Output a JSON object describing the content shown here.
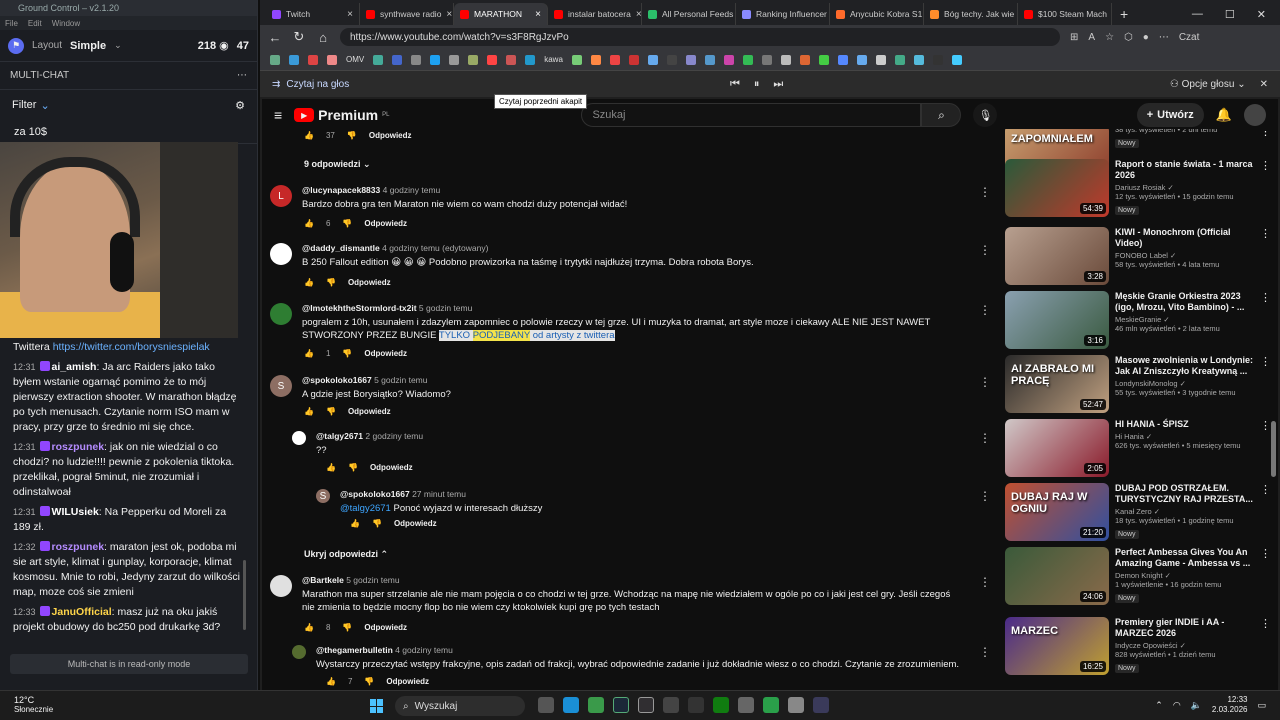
{
  "gc": {
    "title": "Ground Control – v2.1.20",
    "menu": [
      "File",
      "Edit",
      "Window"
    ],
    "layout_label": "Layout",
    "layout_value": "Simple",
    "viewers": "218",
    "viewers2": "47",
    "section": "MULTI-CHAT",
    "filter": "Filter",
    "pinned": "za 10$",
    "readonly": "Multi-chat is in read-only mode",
    "chat": [
      {
        "pre": "Twittera",
        "link": "https://twitter.com/borysniespielak"
      },
      {
        "time": "12:31",
        "user": "ai_amish",
        "color": "#ffffff",
        "text": "Ja arc Raiders jako tako byłem wstanie ogarnąć pomimo że to mój pierwszy extraction shooter. W marathon błądzę po tych menusach. Czytanie norm ISO mam w pracy, przy grze to średnio mi się chce."
      },
      {
        "time": "12:31",
        "user": "roszpunek",
        "color": "#b58cff",
        "text": "jak on nie wiedzial o co chodzi? no ludzie!!!! pewnie z pokolenia tiktoka. przeklikał, pograł 5minut, nie zrozumiał i odinstalwoał"
      },
      {
        "time": "12:31",
        "user": "WILUsiek",
        "color": "#ffffff",
        "text": "Na Pepperku od Moreli za 189 zł."
      },
      {
        "time": "12:32",
        "user": "roszpunek",
        "color": "#b58cff",
        "text": "maraton jest ok, podoba mi sie art style, klimat i gunplay, korporacje, klimat kosmosu. Mnie to robi, Jedyny zarzut do wilkości map, moze coś sie zmieni"
      },
      {
        "time": "12:33",
        "user": "JanuOfficial",
        "color": "#ffd54a",
        "text": "masz już na oku jakiś projekt obudowy do bc250 pod drukarkę 3d?"
      }
    ]
  },
  "browser": {
    "tabs": [
      {
        "label": "Twitch",
        "color": "#9146ff"
      },
      {
        "label": "synthwave radio",
        "color": "#ff0000"
      },
      {
        "label": "MARATHON",
        "color": "#ff0000",
        "active": true
      },
      {
        "label": "instalar batocera",
        "color": "#ff0000"
      },
      {
        "label": "All Personal Feeds",
        "color": "#2bbf6a"
      },
      {
        "label": "Ranking Influencer",
        "color": "#8a8aff"
      },
      {
        "label": "Anycubic Kobra S1",
        "color": "#ff6a2b"
      },
      {
        "label": "Bóg techy. Jak wie",
        "color": "#ff8c2b"
      },
      {
        "label": "$100 Steam Mach",
        "color": "#ff0000"
      }
    ],
    "url": "https://www.youtube.com/watch?v=s3F8RgJzvPo",
    "bookmark_label": "OMV",
    "bookmark_label2": "kawa",
    "reader_label": "Czytaj na głos",
    "reader_options": "Opcje głosu",
    "tooltip": "Czytaj poprzedni akapit",
    "chat_btn": "Czat"
  },
  "yt": {
    "logo": "Premium",
    "logo_sup": "PL",
    "search_placeholder": "Szukaj",
    "create": "Utwórz",
    "reply": "Odpowiedz",
    "replies_count": "9 odpowiedzi",
    "hide_replies": "Ukryj odpowiedzi",
    "comments": [
      {
        "likes": "37",
        "top": 0
      },
      {
        "author": "@lucynapacek8833",
        "time": "4 godziny temu",
        "text": "Bardzo dobra gra ten Maraton nie wiem co wam chodzi duży potencjał widać!",
        "likes": "6",
        "color": "#c62828",
        "letter": "L"
      },
      {
        "author": "@daddy_dismantle",
        "time": "4 godziny temu (edytowany)",
        "text": "B 250 Fallout edition 😀 😀 😀  Podobno prowizorka na taśmę i trytytki najdłużej trzyma. Dobra robota Borys.",
        "likes": "",
        "color": "#ffffff"
      },
      {
        "author": "@ImotekhtheStormlord-tx2it",
        "time": "5 godzin temu",
        "text1": "pogralem z 10h, usunałem i zdazylem zapomniec o polowie rzeczy w tej grze. UI i muzyka to dramat, art style moze i ciekawy ALE NIE JEST NAWET STWORZONY PRZEZ BUNGIE ",
        "hl_a": "TYLKO ",
        "hl_b": "PODJEBANY",
        "hl_c": " od artysty z twittera",
        "likes": "1",
        "color": "#2e7d32"
      },
      {
        "author": "@spokoloko1667",
        "time": "5 godzin temu",
        "text": "A gdzie jest Borysiątko? Wiadomo?",
        "likes": "",
        "color": "#8d6e63",
        "letter": "S"
      },
      {
        "author": "@talgy2671",
        "time": "2 godziny temu",
        "text": "??",
        "color": "#ffffff"
      },
      {
        "author": "@spokoloko1667",
        "time": "27 minut temu",
        "mention": "@talgy2671",
        "text": "Ponoć wyjazd w interesach dłuższy",
        "color": "#8d6e63",
        "letter": "S"
      },
      {
        "author": "@Bartkele",
        "time": "5 godzin temu",
        "text": "Marathon ma super strzelanie ale nie mam pojęcia o co chodzi w tej grze. Wchodząc na mapę nie wiedziałem w ogóle po co i jaki jest cel gry. Jeśli czegoś nie zmienia to będzie mocny flop bo nie wiem czy ktokolwiek kupi grę po tych testach",
        "likes": "8",
        "color": "#e0e0e0"
      },
      {
        "author": "@thegamerbulletin",
        "time": "4 godziny temu",
        "text": "Wystarczy przeczytać wstępy frakcyjne, opis zadań od frakcji, wybrać odpowiednie zadanie i już dokładnie wiesz o co chodzi. Czytanie ze zrozumieniem.",
        "likes": "7",
        "color": "#556b2f"
      }
    ],
    "videos": [
      {
        "title": "",
        "channel": "",
        "meta": "38 tys. wyświetleń • 2 dni temu",
        "badge": "Nowy",
        "dur": "22:17",
        "c1": "#c8a070",
        "c2": "#8b3a2a",
        "thumb_text": "ZAPOMNIAŁEM"
      },
      {
        "title": "Raport o stanie świata - 1 marca 2026",
        "channel": "Dariusz Rosiak",
        "meta": "12 tys. wyświetleń • 15 godzin temu",
        "badge": "Nowy",
        "dur": "54:39",
        "c1": "#2a5a3a",
        "c2": "#c0392b"
      },
      {
        "title": "KIWI - Monochrom (Official Video)",
        "channel": "FONOBO Label",
        "meta": "58 tys. wyświetleń • 4 lata temu",
        "badge": "",
        "dur": "3:28",
        "c1": "#b8a090",
        "c2": "#6a4a3a"
      },
      {
        "title": "Męskie Granie Orkiestra 2023 (igo, Mrozu, Vito Bambino) - ...",
        "channel": "MeskieGranie",
        "meta": "46 mln wyświetleń • 2 lata temu",
        "badge": "",
        "dur": "3:16",
        "c1": "#8aa0b0",
        "c2": "#3a5a40"
      },
      {
        "title": "Masowe zwolnienia w Londynie: Jak AI Zniszczyło Kreatywną ...",
        "channel": "LondynskiMonolog",
        "meta": "55 tys. wyświetleń • 3 tygodnie temu",
        "badge": "",
        "dur": "52:47",
        "c1": "#2a2a2a",
        "c2": "#c0a080",
        "thumb_text": "AI ZABRAŁO MI PRACĘ"
      },
      {
        "title": "HI HANIA - ŚPISZ",
        "channel": "Hi Hania",
        "meta": "626 tys. wyświetleń • 5 miesięcy temu",
        "badge": "",
        "dur": "2:05",
        "c1": "#d0c8c8",
        "c2": "#8a1a2a"
      },
      {
        "title": "DUBAJ POD OSTRZAŁEM. TURYSTYCZNY RAJ PRZESTA...",
        "channel": "Kanał Zero",
        "meta": "18 tys. wyświetleń • 1 godzinę temu",
        "badge": "Nowy",
        "dur": "21:20",
        "c1": "#c05030",
        "c2": "#3050a0",
        "thumb_text": "DUBAJ RAJ W OGNIU"
      },
      {
        "title": "Perfect Ambessa Gives You An Amazing Game - Ambessa vs ...",
        "channel": "Demon Knight",
        "meta": "1 wyświetlenie • 16 godzin temu",
        "badge": "Nowy",
        "dur": "24:06",
        "c1": "#3a5a3a",
        "c2": "#8a6a4a"
      },
      {
        "title": "Premiery gier INDIE i AA - MARZEC 2026",
        "channel": "Indycze Opowieści",
        "meta": "828 wyświetleń • 1 dzień temu",
        "badge": "Nowy",
        "dur": "16:25",
        "c1": "#4a2a8a",
        "c2": "#c0a030",
        "thumb_text": "MARZEC"
      }
    ]
  },
  "taskbar": {
    "temp": "12°C",
    "weather": "Słonecznie",
    "search": "Wyszukaj",
    "time": "12:33",
    "date": "2.03.2026"
  }
}
